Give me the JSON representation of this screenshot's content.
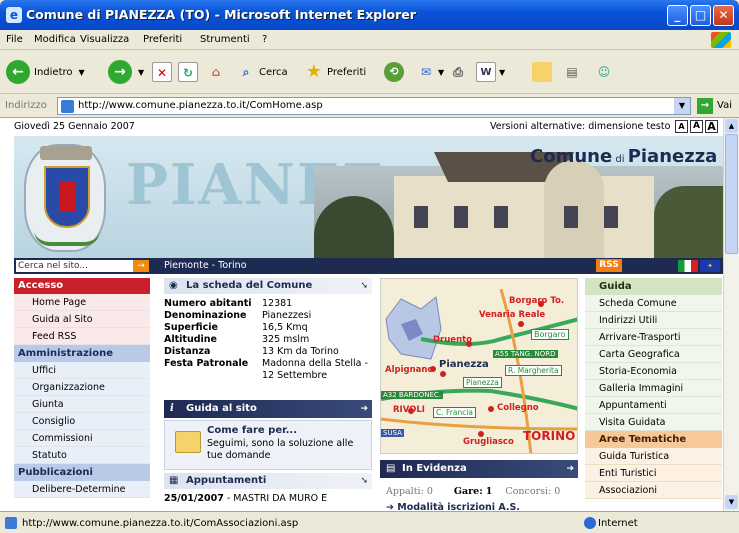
{
  "window": {
    "title": "Comune di PIANEZZA (TO) - Microsoft Internet Explorer"
  },
  "menu": [
    "File",
    "Modifica",
    "Visualizza",
    "Preferiti",
    "Strumenti",
    "?"
  ],
  "toolbar": {
    "back": "Indietro",
    "search": "Cerca",
    "favorites": "Preferiti"
  },
  "address": {
    "label": "Indirizzo",
    "url": "http://www.comune.pianezza.to.it/ComHome.asp",
    "go": "Vai"
  },
  "page": {
    "date": "Giovedì 25 Gennaio 2007",
    "alt_versions": "Versioni alternative: dimensione testo",
    "text_size": [
      "A",
      "A",
      "A"
    ],
    "banner_title_pre": "Comune",
    "banner_title_di": "di",
    "banner_title": "Pianezza",
    "banner_bg_text": "PIANEZ",
    "search_placeholder": "Cerca nel sito...",
    "location": "Piemonte - Torino",
    "rss": "RSS"
  },
  "left_menu": {
    "accesso": {
      "title": "Accesso",
      "items": [
        "Home Page",
        "Guida al Sito",
        "Feed RSS"
      ]
    },
    "amministrazione": {
      "title": "Amministrazione",
      "items": [
        "Uffici",
        "Organizzazione",
        "Giunta",
        "Consiglio",
        "Commissioni",
        "Statuto"
      ]
    },
    "pubblicazioni": {
      "title": "Pubblicazioni",
      "items": [
        "Delibere-Determine"
      ]
    }
  },
  "scheda": {
    "title": "La scheda del Comune",
    "rows": [
      {
        "k": "Numero abitanti",
        "v": "12381"
      },
      {
        "k": "Denominazione",
        "v": "Pianezzesi"
      },
      {
        "k": "Superficie",
        "v": "16,5 Kmq"
      },
      {
        "k": "Altitudine",
        "v": "325 mslm"
      },
      {
        "k": "Distanza",
        "v": "13 Km da Torino"
      },
      {
        "k": "Festa Patronale",
        "v": "Madonna della Stella -"
      },
      {
        "k": "",
        "v": "12 Settembre"
      }
    ]
  },
  "guida_sito": {
    "title": "Guida al sito",
    "heading": "Come fare per...",
    "text1": "Seguimi, sono la soluzione alle",
    "text2": "tue domande"
  },
  "appuntamenti": {
    "title": "Appuntamenti",
    "date": "25/01/2007",
    "text": " - MASTRI DA MURO E"
  },
  "map": {
    "labels": [
      "Borgaro To.",
      "Venaria Reale",
      "Borgaro",
      "Druento",
      "A55 TANG. NORD",
      "Pianezza",
      "R. Margherita",
      "Alpignano",
      "Pianezza",
      "A32 BARDONEC.",
      "RIVOLI",
      "C. Francia",
      "Collegno",
      "SUSA",
      "Grugliasco",
      "TORINO"
    ]
  },
  "in_evidenza": {
    "title": "In Evidenza",
    "appalti_label": "Appalti:",
    "appalti": "0",
    "gare_label": "Gare:",
    "gare": "1",
    "concorsi_label": "Concorsi:",
    "concorsi": "0",
    "next": "Modalità iscrizioni A.S."
  },
  "right_menu": {
    "guida": {
      "title": "Guida",
      "items": [
        "Scheda Comune",
        "Indirizzi Utili",
        "Arrivare-Trasporti",
        "Carta Geografica",
        "Storia-Economia",
        "Galleria Immagini",
        "Appuntamenti",
        "Visita Guidata"
      ]
    },
    "aree": {
      "title": "Aree Tematiche",
      "items": [
        "Guida Turistica",
        "Enti Turistici",
        "Associazioni"
      ]
    }
  },
  "status": {
    "url": "http://www.comune.pianezza.to.it/ComAssociazioni.asp",
    "zone": "Internet"
  }
}
